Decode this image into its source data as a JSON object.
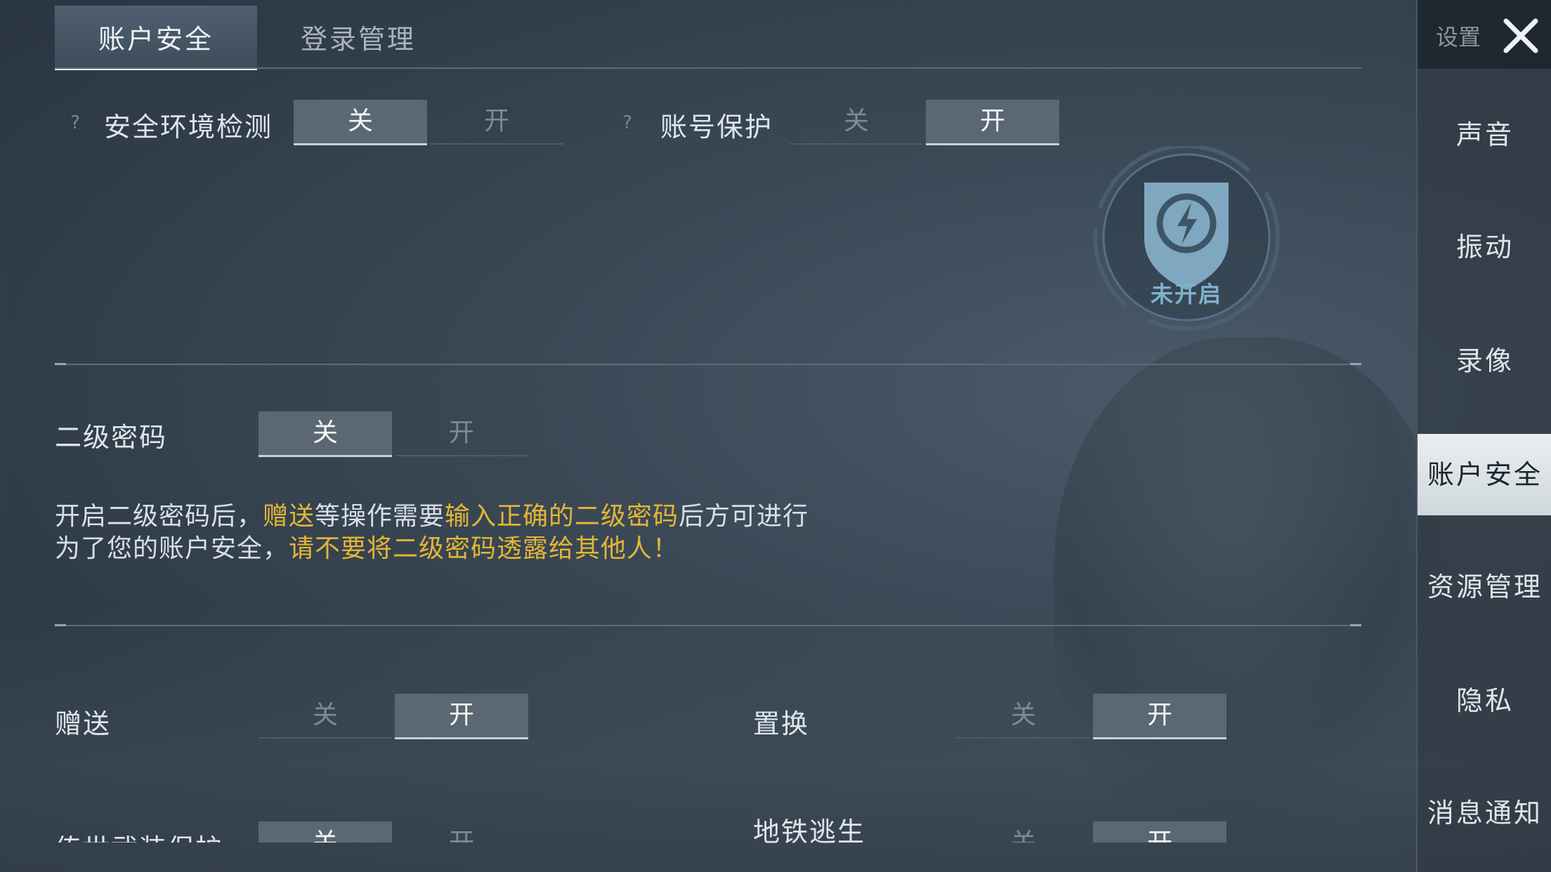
{
  "tabs": [
    {
      "label": "账户安全",
      "active": true
    },
    {
      "label": "登录管理",
      "active": false
    }
  ],
  "security_env": {
    "help": "?",
    "label": "安全环境检测",
    "off": "关",
    "on": "开",
    "state": "off"
  },
  "account_protect": {
    "help": "?",
    "label": "账号保护",
    "off": "关",
    "on": "开",
    "state": "on"
  },
  "shield": {
    "status": "未开启",
    "icon": "lightning-shield-icon"
  },
  "second_password": {
    "label": "二级密码",
    "off": "关",
    "on": "开",
    "state": "off"
  },
  "description": {
    "line1": {
      "a": "开启二级密码后，",
      "b": "赠送",
      "c": "等操作需要",
      "d": "输入正确的二级密码",
      "e": "后方可进行"
    },
    "line2": {
      "a": "为了您的账户安全，",
      "b": "请不要将二级密码透露给其他人！"
    }
  },
  "gift": {
    "label": "赠送",
    "off": "关",
    "on": "开",
    "state": "on"
  },
  "exchange": {
    "label": "置换",
    "off": "关",
    "on": "开",
    "state": "on"
  },
  "legacy_weapon": {
    "label": "传世武装保护",
    "off": "关",
    "on": "开",
    "state": "off"
  },
  "metro": {
    "label": "地铁逃生",
    "off": "关",
    "on": "开",
    "state": "on"
  },
  "sidebar": {
    "title": "设置",
    "close_icon": "close-icon",
    "items": [
      {
        "label": "声音",
        "active": false
      },
      {
        "label": "振动",
        "active": false
      },
      {
        "label": "录像",
        "active": false
      },
      {
        "label": "账户安全",
        "active": true
      },
      {
        "label": "资源管理",
        "active": false
      },
      {
        "label": "隐私",
        "active": false
      },
      {
        "label": "消息通知",
        "active": false
      }
    ]
  },
  "colors": {
    "accent_yellow": "#e3b634",
    "shield_blue": "#7fb2cf",
    "toggle_on": "#5b6773"
  }
}
